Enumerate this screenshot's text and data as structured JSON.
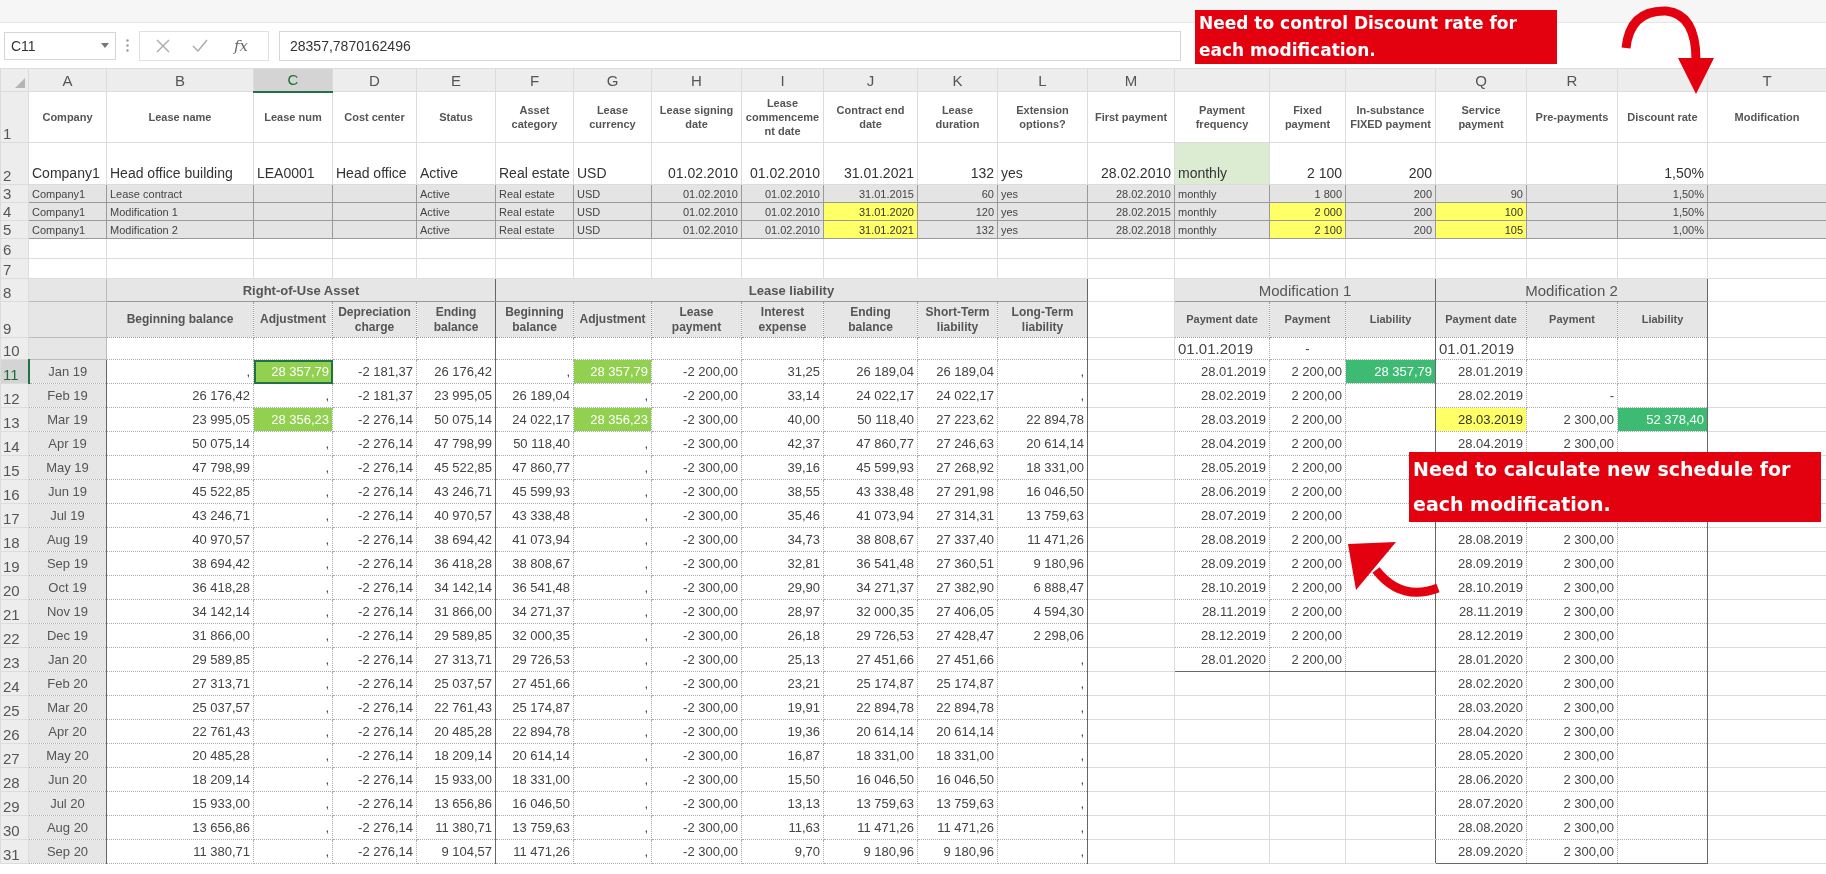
{
  "formula_bar": {
    "name_box": "C11",
    "function_button": "fx",
    "formula": "28357,7870162496"
  },
  "sheet": {
    "columns": [
      {
        "letter": "A",
        "selected": false
      },
      {
        "letter": "B",
        "selected": false
      },
      {
        "letter": "C",
        "selected": true
      },
      {
        "letter": "D",
        "selected": false
      },
      {
        "letter": "E",
        "selected": false
      },
      {
        "letter": "F",
        "selected": false
      },
      {
        "letter": "G",
        "selected": false
      },
      {
        "letter": "H",
        "selected": false
      },
      {
        "letter": "I",
        "selected": false
      },
      {
        "letter": "J",
        "selected": false
      },
      {
        "letter": "K",
        "selected": false
      },
      {
        "letter": "L",
        "selected": false
      },
      {
        "letter": "M",
        "selected": false
      },
      null,
      null,
      null,
      {
        "letter": "Q",
        "selected": false
      },
      {
        "letter": "R",
        "selected": false
      },
      null,
      {
        "letter": "T",
        "selected": false
      }
    ],
    "rows": [
      {
        "label": "1",
        "selected": false
      },
      {
        "label": "2",
        "selected": false
      },
      {
        "label": "3",
        "selected": false
      },
      {
        "label": "4",
        "selected": false
      },
      {
        "label": "5",
        "selected": false
      },
      {
        "label": "6",
        "selected": false
      },
      {
        "label": "7",
        "selected": false
      },
      {
        "label": "8",
        "selected": false
      },
      {
        "label": "9",
        "selected": false
      },
      {
        "label": "10",
        "selected": false
      },
      {
        "label": "11",
        "selected": true
      },
      {
        "label": "12",
        "selected": false
      },
      {
        "label": "13",
        "selected": false
      },
      {
        "label": "14",
        "selected": false
      },
      {
        "label": "15",
        "selected": false
      },
      {
        "label": "16",
        "selected": false
      },
      {
        "label": "17",
        "selected": false
      },
      {
        "label": "18",
        "selected": false
      },
      {
        "label": "19",
        "selected": false
      },
      {
        "label": "20",
        "selected": false
      },
      {
        "label": "21",
        "selected": false
      },
      {
        "label": "22",
        "selected": false
      },
      {
        "label": "23",
        "selected": false
      },
      {
        "label": "24",
        "selected": false
      },
      {
        "label": "25",
        "selected": false
      },
      {
        "label": "26",
        "selected": false
      },
      {
        "label": "27",
        "selected": false
      },
      {
        "label": "28",
        "selected": false
      },
      {
        "label": "29",
        "selected": false
      },
      {
        "label": "30",
        "selected": false
      },
      {
        "label": "31",
        "selected": false
      }
    ]
  },
  "lease_table": {
    "headers": [
      "Company",
      "Lease name",
      "Lease num",
      "Cost center",
      "Status",
      "Asset category",
      "Lease currency",
      "Lease signing date",
      "Lease commencement date",
      "Contract end date",
      "Lease duration",
      "Extension options?",
      "First payment",
      "Payment frequency",
      "Fixed payment",
      "In-substance FIXED payment",
      "Service payment",
      "Pre-payments",
      "Discount rate",
      "Modification"
    ],
    "rows": [
      {
        "kind": "main",
        "cells": [
          "Company1",
          "Head office building",
          "LEA0001",
          "Head office",
          "Active",
          "Real estate",
          "USD",
          "01.02.2010",
          "01.02.2010",
          "31.01.2021",
          "132",
          "yes",
          "28.02.2010",
          {
            "text": "monthly",
            "color": "#dbecd3"
          },
          "2 100",
          "200",
          null,
          null,
          "1,50%",
          null
        ]
      },
      {
        "kind": "sub",
        "cells": [
          "Company1",
          "Lease contract",
          null,
          null,
          "Active",
          "Real estate",
          "USD",
          "01.02.2010",
          "01.02.2010",
          "31.01.2015",
          "60",
          "yes",
          "28.02.2010",
          "monthly",
          "1 800",
          "200",
          "90",
          null,
          "1,50%",
          null
        ]
      },
      {
        "kind": "sub",
        "cells": [
          "Company1",
          "Modification 1",
          null,
          null,
          "Active",
          "Real estate",
          "USD",
          "01.02.2010",
          "01.02.2010",
          {
            "text": "31.01.2020",
            "color": "#ffff66"
          },
          "120",
          "yes",
          "28.02.2015",
          "monthly",
          {
            "text": "2 000",
            "color": "#ffff66"
          },
          "200",
          {
            "text": "100",
            "color": "#ffff66"
          },
          null,
          "1,50%",
          null
        ]
      },
      {
        "kind": "sub",
        "cells": [
          "Company1",
          "Modification 2",
          null,
          null,
          "Active",
          "Real estate",
          "USD",
          "01.02.2010",
          "01.02.2010",
          {
            "text": "31.01.2021",
            "color": "#ffff66"
          },
          "132",
          "yes",
          "28.02.2018",
          "monthly",
          {
            "text": "2 100",
            "color": "#ffff66"
          },
          "200",
          {
            "text": "105",
            "color": "#ffff66"
          },
          null,
          "1,00%",
          null
        ]
      }
    ]
  },
  "schedule": {
    "groups": [
      {
        "title": "Right-of-Use Asset",
        "columns": [
          "Beginning balance",
          "Adjustment",
          "Depreciation charge",
          "Ending balance"
        ]
      },
      {
        "title": "Lease liability",
        "columns": [
          "Beginning balance",
          "Adjustment",
          "Lease payment",
          "Interest expense",
          "Ending balance",
          "Short-Term liability",
          "Long-Term liability"
        ]
      }
    ],
    "rows": [
      {
        "month": "Jan 19",
        "values": [
          ",",
          {
            "text": "28 357,79",
            "color": "#92d050"
          },
          "-2 181,37",
          "26 176,42",
          ",",
          {
            "text": "28 357,79",
            "color": "#92d050"
          },
          "-2 200,00",
          "31,25",
          "26 189,04",
          "26 189,04",
          ","
        ]
      },
      {
        "month": "Feb 19",
        "values": [
          "26 176,42",
          ",",
          "-2 181,37",
          "23 995,05",
          "26 189,04",
          ",",
          "-2 200,00",
          "33,14",
          "24 022,17",
          "24 022,17",
          ","
        ]
      },
      {
        "month": "Mar 19",
        "values": [
          "23 995,05",
          {
            "text": "28 356,23",
            "color": "#92d050"
          },
          "-2 276,14",
          "50 075,14",
          "24 022,17",
          {
            "text": "28 356,23",
            "color": "#92d050"
          },
          "-2 300,00",
          "40,00",
          "50 118,40",
          "27 223,62",
          "22 894,78"
        ]
      },
      {
        "month": "Apr 19",
        "values": [
          "50 075,14",
          ",",
          "-2 276,14",
          "47 798,99",
          "50 118,40",
          ",",
          "-2 300,00",
          "42,37",
          "47 860,77",
          "27 246,63",
          "20 614,14"
        ]
      },
      {
        "month": "May 19",
        "values": [
          "47 798,99",
          ",",
          "-2 276,14",
          "45 522,85",
          "47 860,77",
          ",",
          "-2 300,00",
          "39,16",
          "45 599,93",
          "27 268,92",
          "18 331,00"
        ]
      },
      {
        "month": "Jun 19",
        "values": [
          "45 522,85",
          ",",
          "-2 276,14",
          "43 246,71",
          "45 599,93",
          ",",
          "-2 300,00",
          "38,55",
          "43 338,48",
          "27 291,98",
          "16 046,50"
        ]
      },
      {
        "month": "Jul 19",
        "values": [
          "43 246,71",
          ",",
          "-2 276,14",
          "40 970,57",
          "43 338,48",
          ",",
          "-2 300,00",
          "35,46",
          "41 073,94",
          "27 314,31",
          "13 759,63"
        ]
      },
      {
        "month": "Aug 19",
        "values": [
          "40 970,57",
          ",",
          "-2 276,14",
          "38 694,42",
          "41 073,94",
          ",",
          "-2 300,00",
          "34,73",
          "38 808,67",
          "27 337,40",
          "11 471,26"
        ]
      },
      {
        "month": "Sep 19",
        "values": [
          "38 694,42",
          ",",
          "-2 276,14",
          "36 418,28",
          "38 808,67",
          ",",
          "-2 300,00",
          "32,81",
          "36 541,48",
          "27 360,51",
          "9 180,96"
        ]
      },
      {
        "month": "Oct 19",
        "values": [
          "36 418,28",
          ",",
          "-2 276,14",
          "34 142,14",
          "36 541,48",
          ",",
          "-2 300,00",
          "29,90",
          "34 271,37",
          "27 382,90",
          "6 888,47"
        ]
      },
      {
        "month": "Nov 19",
        "values": [
          "34 142,14",
          ",",
          "-2 276,14",
          "31 866,00",
          "34 271,37",
          ",",
          "-2 300,00",
          "28,97",
          "32 000,35",
          "27 406,05",
          "4 594,30"
        ]
      },
      {
        "month": "Dec 19",
        "values": [
          "31 866,00",
          ",",
          "-2 276,14",
          "29 589,85",
          "32 000,35",
          ",",
          "-2 300,00",
          "26,18",
          "29 726,53",
          "27 428,47",
          "2 298,06"
        ]
      },
      {
        "month": "Jan 20",
        "values": [
          "29 589,85",
          ",",
          "-2 276,14",
          "27 313,71",
          "29 726,53",
          ",",
          "-2 300,00",
          "25,13",
          "27 451,66",
          "27 451,66",
          ","
        ]
      },
      {
        "month": "Feb 20",
        "values": [
          "27 313,71",
          ",",
          "-2 276,14",
          "25 037,57",
          "27 451,66",
          ",",
          "-2 300,00",
          "23,21",
          "25 174,87",
          "25 174,87",
          ","
        ]
      },
      {
        "month": "Mar 20",
        "values": [
          "25 037,57",
          ",",
          "-2 276,14",
          "22 761,43",
          "25 174,87",
          ",",
          "-2 300,00",
          "19,91",
          "22 894,78",
          "22 894,78",
          ","
        ]
      },
      {
        "month": "Apr 20",
        "values": [
          "22 761,43",
          ",",
          "-2 276,14",
          "20 485,28",
          "22 894,78",
          ",",
          "-2 300,00",
          "19,36",
          "20 614,14",
          "20 614,14",
          ","
        ]
      },
      {
        "month": "May 20",
        "values": [
          "20 485,28",
          ",",
          "-2 276,14",
          "18 209,14",
          "20 614,14",
          ",",
          "-2 300,00",
          "16,87",
          "18 331,00",
          "18 331,00",
          ","
        ]
      },
      {
        "month": "Jun 20",
        "values": [
          "18 209,14",
          ",",
          "-2 276,14",
          "15 933,00",
          "18 331,00",
          ",",
          "-2 300,00",
          "15,50",
          "16 046,50",
          "16 046,50",
          ","
        ]
      },
      {
        "month": "Jul 20",
        "values": [
          "15 933,00",
          ",",
          "-2 276,14",
          "13 656,86",
          "16 046,50",
          ",",
          "-2 300,00",
          "13,13",
          "13 759,63",
          "13 759,63",
          ","
        ]
      },
      {
        "month": "Aug 20",
        "values": [
          "13 656,86",
          ",",
          "-2 276,14",
          "11 380,71",
          "13 759,63",
          ",",
          "-2 300,00",
          "11,63",
          "11 471,26",
          "11 471,26",
          ","
        ]
      },
      {
        "month": "Sep 20",
        "values": [
          "11 380,71",
          ",",
          "-2 276,14",
          "9 104,57",
          "11 471,26",
          ",",
          "-2 300,00",
          "9,70",
          "9 180,96",
          "9 180,96",
          ","
        ]
      }
    ]
  },
  "modifications": [
    {
      "title": "Modification 1",
      "columns": [
        "Payment date",
        "Payment",
        "Liability"
      ],
      "rows": [
        [
          "01.01.2019",
          "-",
          null
        ],
        [
          "28.01.2019",
          "2 200,00",
          {
            "text": "28 357,79",
            "color": "#3dbb73"
          }
        ],
        [
          "28.02.2019",
          "2 200,00",
          null
        ],
        [
          "28.03.2019",
          "2 200,00",
          null
        ],
        [
          "28.04.2019",
          "2 200,00",
          null
        ],
        [
          "28.05.2019",
          "2 200,00",
          null
        ],
        [
          "28.06.2019",
          "2 200,00",
          null
        ],
        [
          "28.07.2019",
          "2 200,00",
          null
        ],
        [
          "28.08.2019",
          "2 200,00",
          null
        ],
        [
          "28.09.2019",
          "2 200,00",
          null
        ],
        [
          "28.10.2019",
          "2 200,00",
          null
        ],
        [
          "28.11.2019",
          "2 200,00",
          null
        ],
        [
          "28.12.2019",
          "2 200,00",
          null
        ],
        [
          "28.01.2020",
          "2 200,00",
          null
        ]
      ]
    },
    {
      "title": "Modification 2",
      "columns": [
        "Payment date",
        "Payment",
        "Liability"
      ],
      "rows": [
        [
          "01.01.2019",
          null,
          null
        ],
        [
          "28.01.2019",
          null,
          null
        ],
        [
          "28.02.2019",
          "-",
          null
        ],
        [
          {
            "text": "28.03.2019",
            "color": "#ffff66"
          },
          "2 300,00",
          {
            "text": "52 378,40",
            "color": "#3dbb73"
          }
        ],
        [
          "28.04.2019",
          "2 300,00",
          null
        ],
        [
          null,
          null,
          null
        ],
        [
          null,
          null,
          null
        ],
        [
          null,
          null,
          null
        ],
        [
          "28.08.2019",
          "2 300,00",
          null
        ],
        [
          "28.09.2019",
          "2 300,00",
          null
        ],
        [
          "28.10.2019",
          "2 300,00",
          null
        ],
        [
          "28.11.2019",
          "2 300,00",
          null
        ],
        [
          "28.12.2019",
          "2 300,00",
          null
        ],
        [
          "28.01.2020",
          "2 300,00",
          null
        ],
        [
          "28.02.2020",
          "2 300,00",
          null
        ],
        [
          "28.03.2020",
          "2 300,00",
          null
        ],
        [
          "28.04.2020",
          "2 300,00",
          null
        ],
        [
          "28.05.2020",
          "2 300,00",
          null
        ],
        [
          "28.06.2020",
          "2 300,00",
          null
        ],
        [
          "28.07.2020",
          "2 300,00",
          null
        ],
        [
          "28.08.2020",
          "2 300,00",
          null
        ],
        [
          "28.09.2020",
          "2 300,00",
          null
        ]
      ]
    }
  ],
  "annotations": [
    {
      "text": "Need to control Discount rate for each modification."
    },
    {
      "text": "Need to calculate new schedule for each modification."
    }
  ]
}
